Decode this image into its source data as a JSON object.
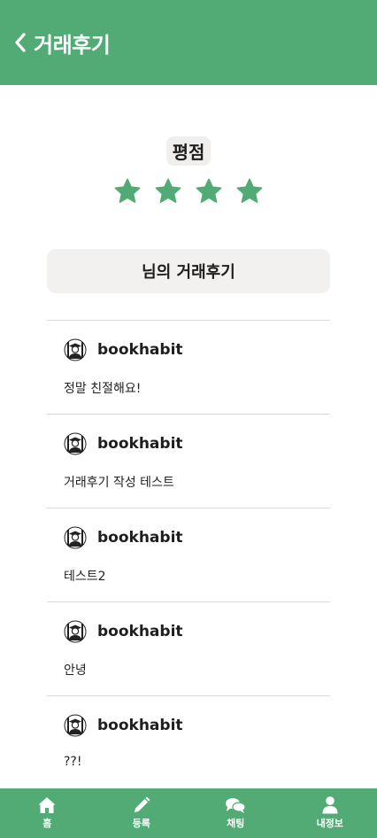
{
  "header": {
    "title": "거래후기"
  },
  "rating": {
    "label": "평점",
    "stars": 4,
    "star_color": "#52ab74"
  },
  "reviews_section": {
    "title": "님의 거래후기"
  },
  "reviews": [
    {
      "username": "bookhabit",
      "text": "정말 친절해요!"
    },
    {
      "username": "bookhabit",
      "text": "거래후기 작성 테스트"
    },
    {
      "username": "bookhabit",
      "text": "테스트2"
    },
    {
      "username": "bookhabit",
      "text": "안녕"
    },
    {
      "username": "bookhabit",
      "text": "??!"
    }
  ],
  "bottom_nav": {
    "items": [
      {
        "label": "홈",
        "icon": "home-icon"
      },
      {
        "label": "등록",
        "icon": "pencil-icon"
      },
      {
        "label": "채팅",
        "icon": "chat-icon"
      },
      {
        "label": "내정보",
        "icon": "user-icon"
      }
    ]
  },
  "colors": {
    "brand": "#52ab74",
    "label_bg": "#f3f1ef",
    "divider": "#d9d9d9"
  }
}
